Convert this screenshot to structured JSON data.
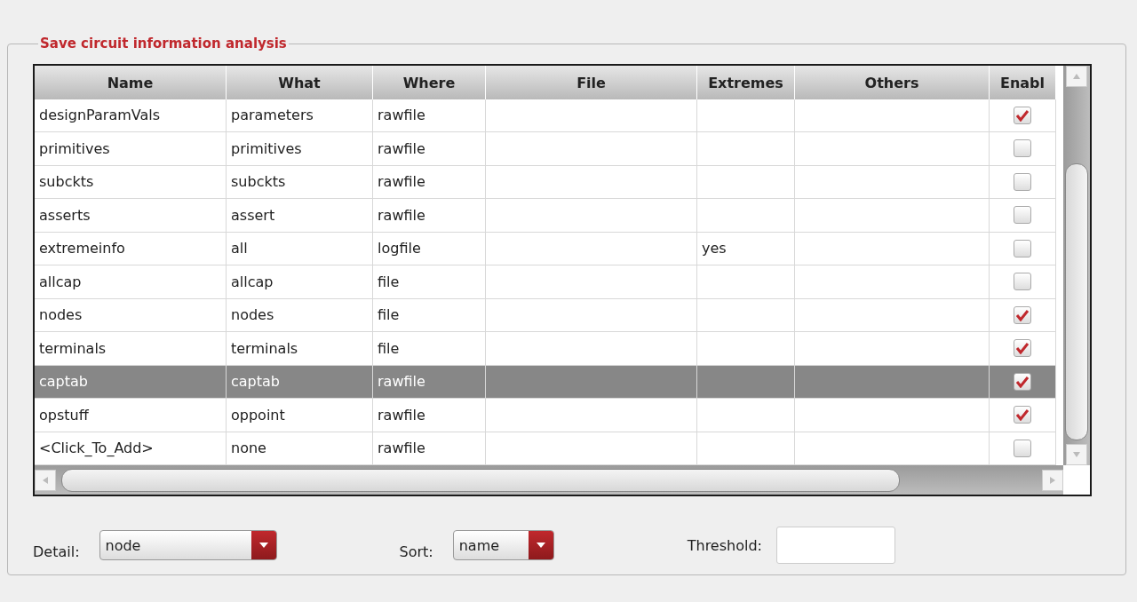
{
  "group": {
    "title": "Save circuit information analysis"
  },
  "table": {
    "columns": [
      "Name",
      "What",
      "Where",
      "File",
      "Extremes",
      "Others",
      "Enabl"
    ],
    "rows": [
      {
        "name": "designParamVals",
        "what": "parameters",
        "where": "rawfile",
        "file": "",
        "extremes": "",
        "others": "",
        "enabled": true,
        "selected": false
      },
      {
        "name": "primitives",
        "what": "primitives",
        "where": "rawfile",
        "file": "",
        "extremes": "",
        "others": "",
        "enabled": false,
        "selected": false
      },
      {
        "name": "subckts",
        "what": "subckts",
        "where": "rawfile",
        "file": "",
        "extremes": "",
        "others": "",
        "enabled": false,
        "selected": false
      },
      {
        "name": "asserts",
        "what": "assert",
        "where": "rawfile",
        "file": "",
        "extremes": "",
        "others": "",
        "enabled": false,
        "selected": false
      },
      {
        "name": "extremeinfo",
        "what": "all",
        "where": "logfile",
        "file": "",
        "extremes": "yes",
        "others": "",
        "enabled": false,
        "selected": false
      },
      {
        "name": "allcap",
        "what": "allcap",
        "where": "file",
        "file": "",
        "extremes": "",
        "others": "",
        "enabled": false,
        "selected": false
      },
      {
        "name": "nodes",
        "what": "nodes",
        "where": "file",
        "file": "",
        "extremes": "",
        "others": "",
        "enabled": true,
        "selected": false
      },
      {
        "name": "terminals",
        "what": "terminals",
        "where": "file",
        "file": "",
        "extremes": "",
        "others": "",
        "enabled": true,
        "selected": false
      },
      {
        "name": "captab",
        "what": "captab",
        "where": "rawfile",
        "file": "",
        "extremes": "",
        "others": "",
        "enabled": true,
        "selected": true
      },
      {
        "name": "opstuff",
        "what": "oppoint",
        "where": "rawfile",
        "file": "",
        "extremes": "",
        "others": "",
        "enabled": true,
        "selected": false
      },
      {
        "name": "<Click_To_Add>",
        "what": "none",
        "where": "rawfile",
        "file": "",
        "extremes": "",
        "others": "",
        "enabled": false,
        "selected": false
      }
    ]
  },
  "controls": {
    "detail_label": "Detail:",
    "detail_value": "node",
    "sort_label": "Sort:",
    "sort_value": "name",
    "threshold_label": "Threshold:"
  }
}
